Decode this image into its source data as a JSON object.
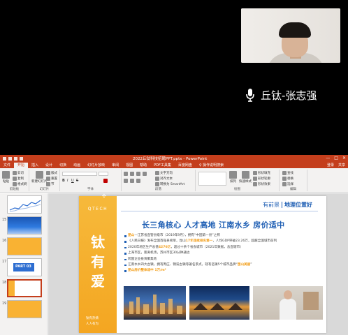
{
  "call": {
    "participant_name": "丘钛-张志强"
  },
  "ppt": {
    "doc_title": "2022丘钛科技招聘PPT.pptx - PowerPoint",
    "window_controls": [
      "—",
      "□",
      "✕"
    ],
    "tabs": [
      "文件",
      "开始",
      "插入",
      "设计",
      "切换",
      "动画",
      "幻灯片放映",
      "审阅",
      "视图",
      "帮助",
      "PDF工具集",
      "百度网盘",
      "♀ 操作说明搜索"
    ],
    "active_tab": "开始",
    "tab_right": [
      "登录",
      "共享"
    ],
    "ribbon": {
      "groups": [
        "剪贴板",
        "幻灯片",
        "字体",
        "段落",
        "绘图",
        "编辑"
      ],
      "clipboard": {
        "paste": "粘贴",
        "cut": "剪切",
        "copy": "复制",
        "format_painter": "格式刷"
      },
      "slides": {
        "new_slide": "新建幻灯片",
        "layout": "版式",
        "reset": "重置",
        "section": "节"
      },
      "font": {
        "font_name": "",
        "font_size": ""
      },
      "paragraph": {
        "text_direction": "文字方向",
        "align_text": "对齐文本",
        "smartart": "转换为 SmartArt"
      },
      "drawing": {
        "arrange": "排列",
        "quick_styles": "快速样式",
        "shape_fill": "形状填充",
        "shape_outline": "形状轮廓",
        "shape_effects": "形状效果"
      },
      "editing": {
        "find": "查找",
        "replace": "替换",
        "select": "选择"
      }
    },
    "thumbnails": [
      {
        "number": "",
        "style": "chart"
      },
      {
        "number": "15",
        "style": "blue"
      },
      {
        "number": "16",
        "style": "yellow"
      },
      {
        "number": "17",
        "style": "part",
        "label": "PART 03"
      },
      {
        "number": "18",
        "style": "slide",
        "selected": true
      },
      {
        "number": "19",
        "style": "yellow"
      }
    ],
    "slide": {
      "logo": "QTECH",
      "big_chars": [
        "钛",
        "有",
        "爱"
      ],
      "band_footer": [
        "钛有热情",
        "人人有为"
      ],
      "header_left": "有前景",
      "header_right": "地理位置好",
      "headline": "长三角核心  人才高地  江南水乡  房价适中",
      "bullets": [
        {
          "pre": "",
          "hl": "昆山",
          "post": "—江苏省直管县级市（2019年9月），拥有“中国第一县”之称"
        },
        {
          "pre": "《人民日报》发布全国百强县榜单，昆山",
          "hl": "17年连续排名第一",
          "post": "，人均GDP突破23.26万，超越全国城市前列"
        },
        {
          "pre": "2020年地区生产总值",
          "hl": "4276亿",
          "post": "，超过十余个省会城市（2021年数据，含直辖市）"
        },
        {
          "pre": "上海市区，距离机场，苏州市区",
          "hl": "",
          "post": "30分钟通达"
        },
        {
          "pre": "跨国企业投资聚集地",
          "hl": "",
          "post": ""
        },
        {
          "pre": "江南水乡四大古镇，拥有周庄、锦溪古镇等著名景点，辖有名镇5个城市品牌“",
          "hl": "昆山美丽",
          "post": "”"
        },
        {
          "pre": "",
          "hl": "昆山房价整体适中 1万/m²",
          "post": ""
        }
      ]
    }
  }
}
